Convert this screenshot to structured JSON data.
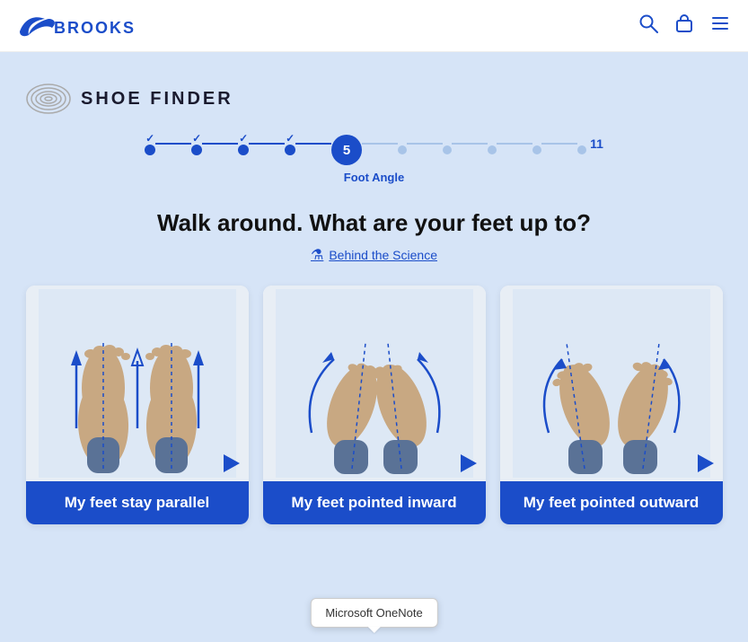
{
  "header": {
    "logo_text": "BROOKS",
    "search_icon": "🔍",
    "bag_icon": "🛍",
    "menu_icon": "☰"
  },
  "page": {
    "title": "SHOE FINDER"
  },
  "progress": {
    "steps_completed": [
      1,
      2,
      3,
      4
    ],
    "active_step": 5,
    "active_step_label": "Foot Angle",
    "total_steps": 11,
    "upcoming_steps": [
      6,
      7,
      8,
      9,
      10
    ]
  },
  "question": {
    "title": "Walk around. What are your feet up to?",
    "science_link": "Behind the Science"
  },
  "cards": [
    {
      "label": "My feet stay parallel",
      "id": "parallel"
    },
    {
      "label": "My feet pointed inward",
      "id": "inward"
    },
    {
      "label": "My feet pointed outward",
      "id": "outward"
    }
  ],
  "tooltip": {
    "text": "Microsoft OneNote"
  }
}
